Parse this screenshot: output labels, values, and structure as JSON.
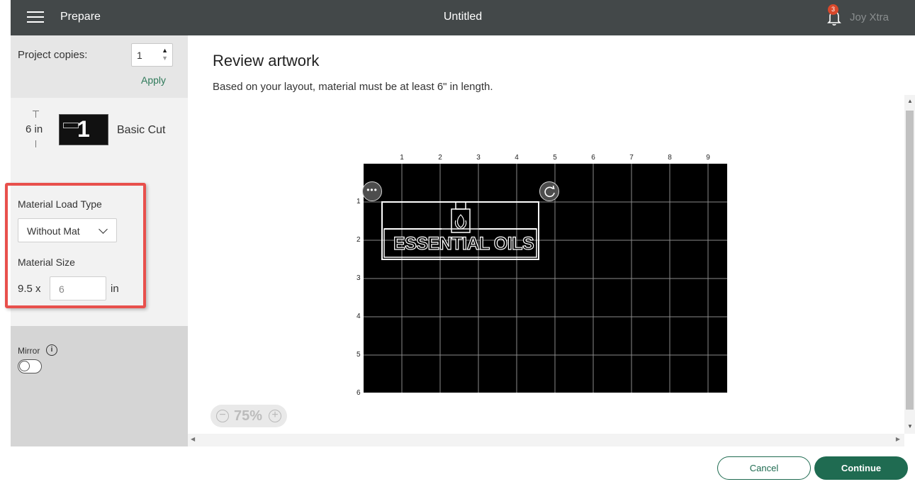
{
  "header": {
    "menu_icon": "hamburger-icon",
    "section": "Prepare",
    "title": "Untitled",
    "notification_count": "3",
    "notification_icon": "bell-icon",
    "user_name": "Joy Xtra"
  },
  "sidebar": {
    "copies_label": "Project copies:",
    "copies_value": "1",
    "apply_label": "Apply",
    "mat": {
      "size": "6 in",
      "thumbnail_number": "1",
      "name": "Basic Cut"
    },
    "load_type_label": "Material Load Type",
    "load_type_value": "Without Mat",
    "size_label": "Material Size",
    "size_width": "9.5 x",
    "size_length": "6",
    "size_unit": "in",
    "mirror_label": "Mirror",
    "mirror_on": false
  },
  "main": {
    "title": "Review artwork",
    "subtitle": "Based on your layout, material must be at least 6\" in length.",
    "column_labels": [
      "1",
      "2",
      "3",
      "4",
      "5",
      "6",
      "7",
      "8",
      "9"
    ],
    "row_labels": [
      "1",
      "2",
      "3",
      "4",
      "5",
      "6"
    ],
    "artwork_text": "ESSENTIAL OILS",
    "zoom_value": "75%"
  },
  "footer": {
    "cancel_label": "Cancel",
    "continue_label": "Continue"
  },
  "colors": {
    "header_bg": "#434849",
    "accent_green": "#1f6b51",
    "highlight_red": "#e8504c",
    "badge_red": "#d9482b"
  }
}
